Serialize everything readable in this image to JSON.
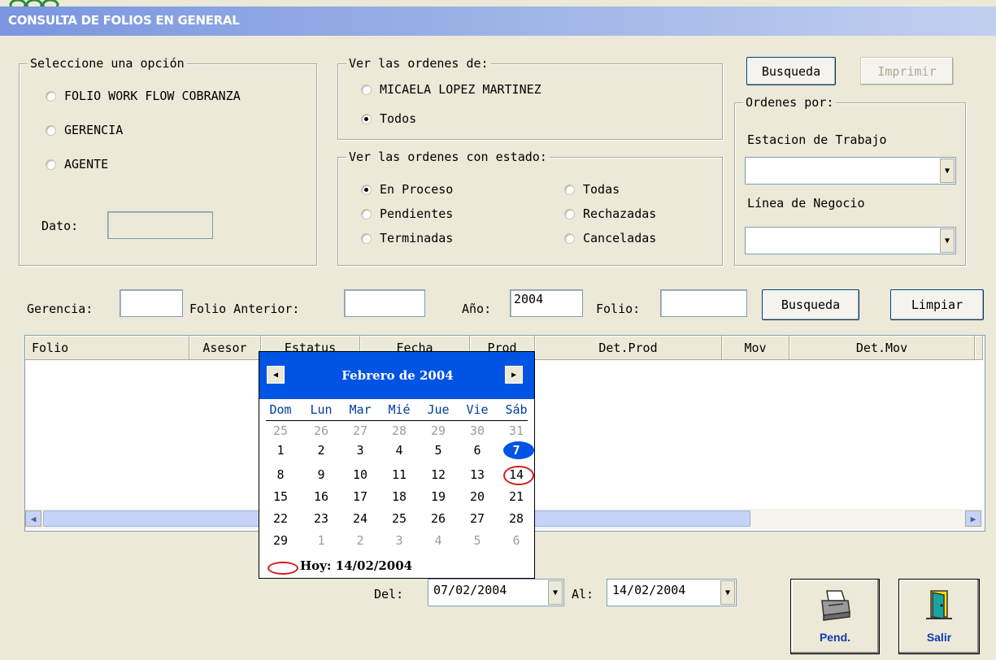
{
  "window": {
    "title": "CONSULTA DE FOLIOS EN GENERAL"
  },
  "option_group": {
    "legend": "Seleccione una opción",
    "options": [
      {
        "label": "FOLIO WORK FLOW COBRANZA",
        "selected": false
      },
      {
        "label": "GERENCIA",
        "selected": false
      },
      {
        "label": "AGENTE",
        "selected": false
      }
    ],
    "dato_label": "Dato:",
    "dato_value": ""
  },
  "owner_group": {
    "legend": "Ver las ordenes de:",
    "options": [
      {
        "label": "MICAELA LOPEZ MARTINEZ",
        "selected": false
      },
      {
        "label": "Todos",
        "selected": true
      }
    ]
  },
  "status_group": {
    "legend": "Ver las ordenes con estado:",
    "options": [
      {
        "label": "En Proceso",
        "selected": true
      },
      {
        "label": "Pendientes",
        "selected": false
      },
      {
        "label": "Terminadas",
        "selected": false
      },
      {
        "label": "Todas",
        "selected": false
      },
      {
        "label": "Rechazadas",
        "selected": false
      },
      {
        "label": "Canceladas",
        "selected": false
      }
    ]
  },
  "top_buttons": {
    "search": "Busqueda",
    "print": "Imprimir"
  },
  "orders_group": {
    "legend": "Ordenes por:",
    "workstation_label": "Estacion de Trabajo",
    "workstation_value": "",
    "business_label": "Línea de Negocio",
    "business_value": ""
  },
  "filters": {
    "gerencia_label": "Gerencia:",
    "gerencia_value": "",
    "folio_anterior_label": "Folio Anterior:",
    "folio_anterior_value": "",
    "anio_label": "Año:",
    "anio_value": "2004",
    "folio_label": "Folio:",
    "folio_value": "",
    "search_button": "Busqueda",
    "clear_button": "Limpiar"
  },
  "grid": {
    "columns": [
      "Folio",
      "Asesor",
      "Estatus",
      "Fecha",
      "Prod",
      "Det.Prod",
      "Mov",
      "Det.Mov"
    ],
    "rows": []
  },
  "calendar": {
    "month_label": "Febrero de 2004",
    "days_of_week": [
      "Dom",
      "Lun",
      "Mar",
      "Mié",
      "Jue",
      "Vie",
      "Sáb"
    ],
    "weeks": [
      [
        "25",
        "26",
        "27",
        "28",
        "29",
        "30",
        "31"
      ],
      [
        "1",
        "2",
        "3",
        "4",
        "5",
        "6",
        "7"
      ],
      [
        "8",
        "9",
        "10",
        "11",
        "12",
        "13",
        "14"
      ],
      [
        "15",
        "16",
        "17",
        "18",
        "19",
        "20",
        "21"
      ],
      [
        "22",
        "23",
        "24",
        "25",
        "26",
        "27",
        "28"
      ],
      [
        "29",
        "1",
        "2",
        "3",
        "4",
        "5",
        "6"
      ]
    ],
    "selected_day": "7",
    "today_day": "14",
    "today_label": "Hoy: 14/02/2004",
    "selected_color": "#0054e3",
    "today_circle_color": "#d01e1e"
  },
  "date_range": {
    "from_label": "Del:",
    "from_value": "07/02/2004",
    "to_label": "Al:",
    "to_value": "14/02/2004"
  },
  "bottom_buttons": {
    "pending": "Pend.",
    "exit": "Salir"
  },
  "icons": {
    "pending": "printer-icon",
    "exit": "door-exit-icon"
  },
  "colors": {
    "title_bar": "#7a96df",
    "background": "#ece9d8",
    "calendar_header": "#0054e3"
  }
}
